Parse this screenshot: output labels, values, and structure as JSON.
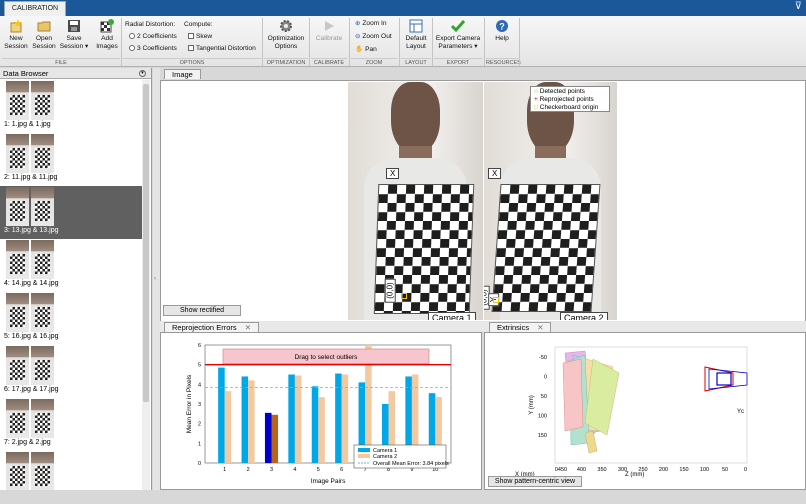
{
  "window": {
    "tab": "CALIBRATION",
    "minimize": "⊽"
  },
  "toolstrip": {
    "file": {
      "new_session": "New\nSession",
      "open_session": "Open\nSession",
      "save_session": "Save\nSession ▾",
      "add_images": "Add\nImages",
      "section": "FILE"
    },
    "options": {
      "radial_label": "Radial Distortion:",
      "coef2": "2 Coefficients",
      "coef3": "3 Coefficients",
      "compute_label": "Compute:",
      "skew": "Skew",
      "tangential": "Tangential Distortion",
      "section": "OPTIONS"
    },
    "optimization": {
      "label": "Optimization\nOptions",
      "section": "OPTIMIZATION"
    },
    "calibrate": {
      "label": "Calibrate",
      "section": "CALIBRATE"
    },
    "zoom": {
      "zoom_in": "Zoom In",
      "zoom_out": "Zoom Out",
      "pan": "Pan",
      "section": "ZOOM"
    },
    "layout": {
      "label": "Default\nLayout",
      "section": "LAYOUT"
    },
    "export": {
      "label": "Export Camera\nParameters ▾",
      "section": "EXPORT"
    },
    "resources": {
      "label": "Help",
      "section": "RESOURCES"
    }
  },
  "browser": {
    "title": "Data Browser",
    "items": [
      {
        "label": "1: 1.jpg & 1.jpg"
      },
      {
        "label": "2: 11.jpg & 11.jpg"
      },
      {
        "label": "3: 13.jpg & 13.jpg"
      },
      {
        "label": "4: 14.jpg & 14.jpg"
      },
      {
        "label": "5: 16.jpg & 16.jpg"
      },
      {
        "label": "6: 17.jpg & 17.jpg"
      },
      {
        "label": "7: 2.jpg & 2.jpg"
      },
      {
        "label": ""
      }
    ],
    "selected_index": 2
  },
  "image_panel": {
    "tab": "Image",
    "camera1": "Camera 1",
    "camera2": "Camera 2",
    "origin": "(0,0)",
    "axis_x": "X",
    "axis_y": "Y",
    "legend": [
      "Detected points",
      "Reprojected points",
      "Checkerboard origin"
    ],
    "show_rectified": "Show rectified"
  },
  "reprojection": {
    "tab": "Reprojection Errors",
    "drag_text": "Drag to select outliers",
    "legend": [
      "Camera 1",
      "Camera 2"
    ],
    "overall": "Overall Mean Error: 3.84 pixels"
  },
  "extrinsics": {
    "tab": "Extrinsics",
    "show_pattern": "Show pattern-centric view",
    "xlabel": "X (mm)",
    "ylabel": "Y (mm)",
    "zlabel": "Z (mm)",
    "yticks": [
      "-50",
      "0",
      "50",
      "100",
      "150"
    ],
    "zticks": [
      "0450",
      "400",
      "350",
      "300",
      "250",
      "200",
      "150",
      "100",
      "50",
      "0"
    ]
  },
  "chart_data": {
    "type": "bar",
    "categories": [
      "1",
      "2",
      "3",
      "4",
      "5",
      "6",
      "7",
      "8",
      "9",
      "10"
    ],
    "series": [
      {
        "name": "Camera 1",
        "values": [
          4.85,
          4.4,
          2.55,
          4.5,
          3.9,
          4.55,
          4.1,
          3.0,
          4.4,
          3.55
        ]
      },
      {
        "name": "Camera 2",
        "values": [
          3.65,
          4.2,
          2.45,
          4.45,
          3.35,
          4.5,
          6.0,
          3.65,
          4.5,
          3.35
        ]
      }
    ],
    "highlighted_index": 2,
    "overall_mean": 3.84,
    "threshold": 5.0,
    "xlabel": "Image Pairs",
    "ylabel": "Mean Error in Pixels",
    "ylim": [
      0,
      6
    ],
    "yticks": [
      0,
      1,
      2,
      3,
      4,
      5,
      6
    ],
    "colors": {
      "camera1": "#00a8e8",
      "camera2": "#f2c9a1",
      "selected1": "#0000cc",
      "selected2": "#b8651b",
      "threshold": "#e00000",
      "mean": "#6cb6d8"
    }
  }
}
